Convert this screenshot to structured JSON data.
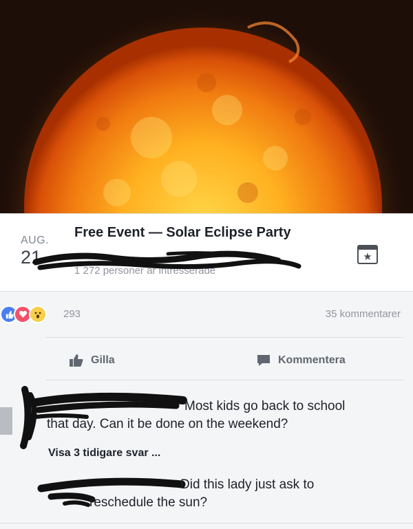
{
  "event": {
    "month": "AUG.",
    "day": "21",
    "title": "Free Event — Solar Eclipse Party",
    "interested": "1 272 personer är intresserade"
  },
  "post": {
    "reaction_count": "293",
    "comment_count": "35 kommentarer",
    "reactions": [
      "like-icon",
      "love-icon",
      "wow-icon"
    ]
  },
  "actions": {
    "like_label": "Gilla",
    "comment_label": "Kommentera"
  },
  "comments": {
    "first_line1": "Most kids go back to school",
    "first_line2": "that day. Can it be done on the weekend?",
    "view_replies": "Visa 3 tidigare svar ...",
    "second_line1": "Did this lady just ask to",
    "second_line2": "reschedule the sun?"
  },
  "colors": {
    "like": "#4a7ff0",
    "love": "#f25268",
    "wow": "#f7cf4a"
  }
}
